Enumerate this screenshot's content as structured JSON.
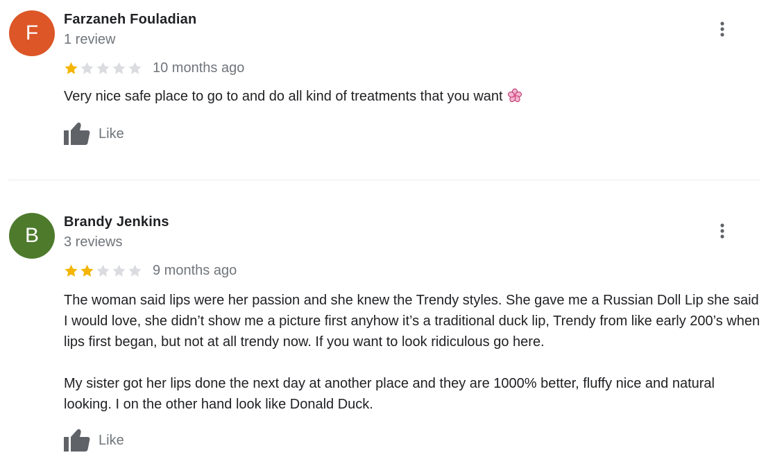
{
  "reviews": [
    {
      "avatar_letter": "F",
      "avatar_color": "#dc5627",
      "name": "Farzaneh Fouladian",
      "review_count": "1 review",
      "rating": 1,
      "max_rating": 5,
      "date": "10 months ago",
      "paragraphs": [
        "Very nice safe place to go to and do all kind of treatments that you want"
      ],
      "emoji": "cherry-blossom-icon",
      "like_label": "Like"
    },
    {
      "avatar_letter": "B",
      "avatar_color": "#4e7a2c",
      "name": "Brandy Jenkins",
      "review_count": "3 reviews",
      "rating": 2,
      "max_rating": 5,
      "date": "9 months ago",
      "paragraphs": [
        "The woman said lips were her passion and she knew the Trendy styles. She gave me a Russian Doll Lip she said I would love, she didn’t show me a picture first anyhow it’s a traditional duck lip, Trendy from like early 200’s when lips first began, but not at all trendy now. If you want to look ridiculous go here.",
        "My sister got her lips done the next day at another place and they are 1000% better, fluffy nice and natural looking. I on the other hand look like Donald Duck."
      ],
      "like_label": "Like"
    }
  ],
  "colors": {
    "star_filled": "#f4b400",
    "star_empty": "#dadce0",
    "secondary_text": "#70757a",
    "icon_gray": "#5f6368"
  }
}
